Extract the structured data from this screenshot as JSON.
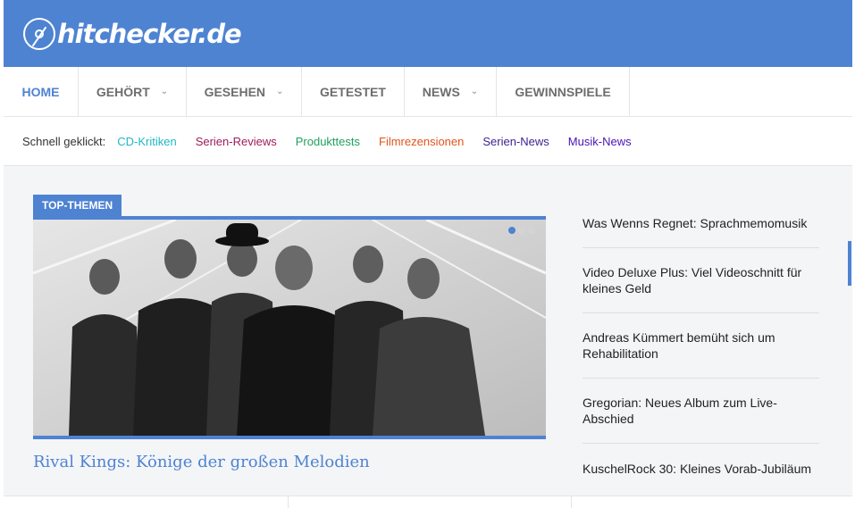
{
  "site": {
    "logo_text": "hitchecker.de"
  },
  "nav": {
    "items": [
      {
        "label": "HOME",
        "has_dropdown": false,
        "active": true
      },
      {
        "label": "GEHÖRT",
        "has_dropdown": true,
        "active": false
      },
      {
        "label": "GESEHEN",
        "has_dropdown": true,
        "active": false
      },
      {
        "label": "GETESTET",
        "has_dropdown": false,
        "active": false
      },
      {
        "label": "NEWS",
        "has_dropdown": true,
        "active": false
      },
      {
        "label": "GEWINNSPIELE",
        "has_dropdown": false,
        "active": false
      }
    ]
  },
  "quick": {
    "label": "Schnell geklickt:",
    "links": [
      {
        "label": "CD-Kritiken",
        "color": "#1fb8c4"
      },
      {
        "label": "Serien-Reviews",
        "color": "#a11a5b"
      },
      {
        "label": "Produkttests",
        "color": "#21a05b"
      },
      {
        "label": "Filmrezensionen",
        "color": "#e2551b"
      },
      {
        "label": "Serien-News",
        "color": "#3b1f8f"
      },
      {
        "label": "Musik-News",
        "color": "#4a13b8"
      }
    ]
  },
  "featured": {
    "badge": "TOP-THEMEN",
    "title": "Rival Kings: Könige der großen Melodien",
    "slide_count": 3,
    "active_slide": 1
  },
  "sidebar": {
    "items": [
      {
        "label": "Was Wenns Regnet: Sprachmemomusik"
      },
      {
        "label": "Video Deluxe Plus: Viel Videoschnitt für kleines Geld"
      },
      {
        "label": "Andreas Kümmert bemüht sich um Rehabilitation"
      },
      {
        "label": "Gregorian: Neues Album zum Live-Abschied"
      },
      {
        "label": "KuschelRock 30: Kleines Vorab-Jubiläum"
      }
    ]
  },
  "colors": {
    "accent": "#4e83d2",
    "icon": "chevron-down-icon"
  }
}
